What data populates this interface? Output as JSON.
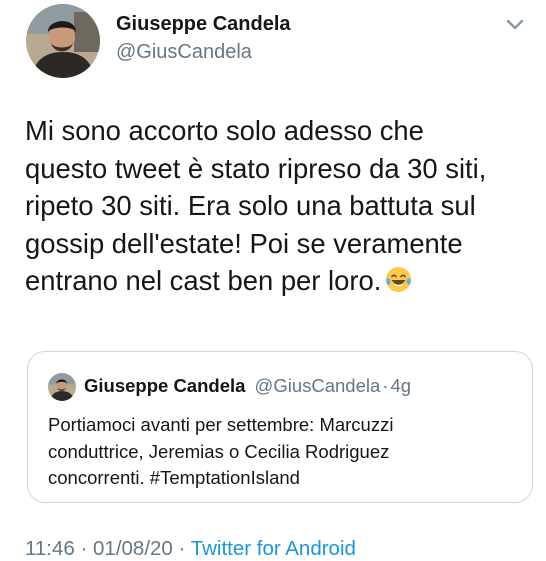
{
  "author": {
    "display_name": "Giuseppe Candela",
    "handle": "@GiusCandela",
    "avatar": "profile-photo"
  },
  "tweet": {
    "lines": [
      "Mi sono accorto solo adesso che",
      "questo tweet è stato ripreso da 30 siti,",
      "ripeto 30 siti. Era solo una battuta sul",
      "gossip dell'estate! Poi se veramente",
      "entrano nel cast ben per loro."
    ],
    "emoji": "tears-of-joy-emoji"
  },
  "quoted_tweet": {
    "display_name": "Giuseppe Candela",
    "handle": "@GiusCandela",
    "separator": "·",
    "age": "4g",
    "lines": [
      "Portiamoci avanti per settembre: Marcuzzi",
      "conduttrice, Jeremias o Cecilia Rodriguez",
      "concorrenti. #TemptationIsland"
    ]
  },
  "meta": {
    "time": "11:46",
    "separator": "·",
    "date": "01/08/20",
    "source": "Twitter for Android"
  },
  "colors": {
    "text": "#14171a",
    "secondary": "#657786",
    "link": "#1b95e0",
    "border": "#ccd6dd"
  },
  "icons": [
    "chevron-down-icon",
    "tears-of-joy-emoji"
  ]
}
